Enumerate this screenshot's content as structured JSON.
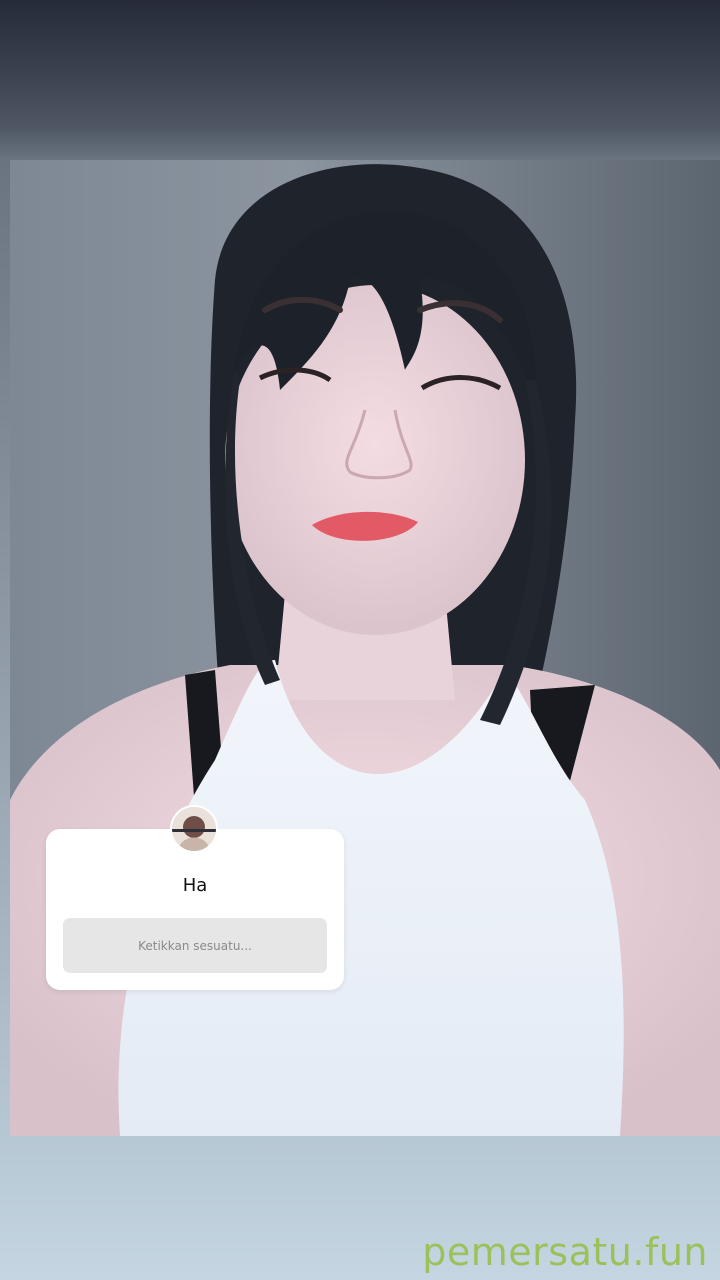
{
  "story": {
    "question_sticker": {
      "question": "Ha",
      "answer_placeholder": "Ketikkan sesuatu..."
    }
  },
  "watermark": {
    "text": "pemersatu.fun",
    "color": "#9bc25a"
  },
  "colors": {
    "background_top": "#262b39",
    "background_bottom": "#c5d6e2",
    "card": "#ffffff",
    "input_fill": "#e6e6e6"
  },
  "icons": {
    "avatar": "profile-avatar"
  }
}
